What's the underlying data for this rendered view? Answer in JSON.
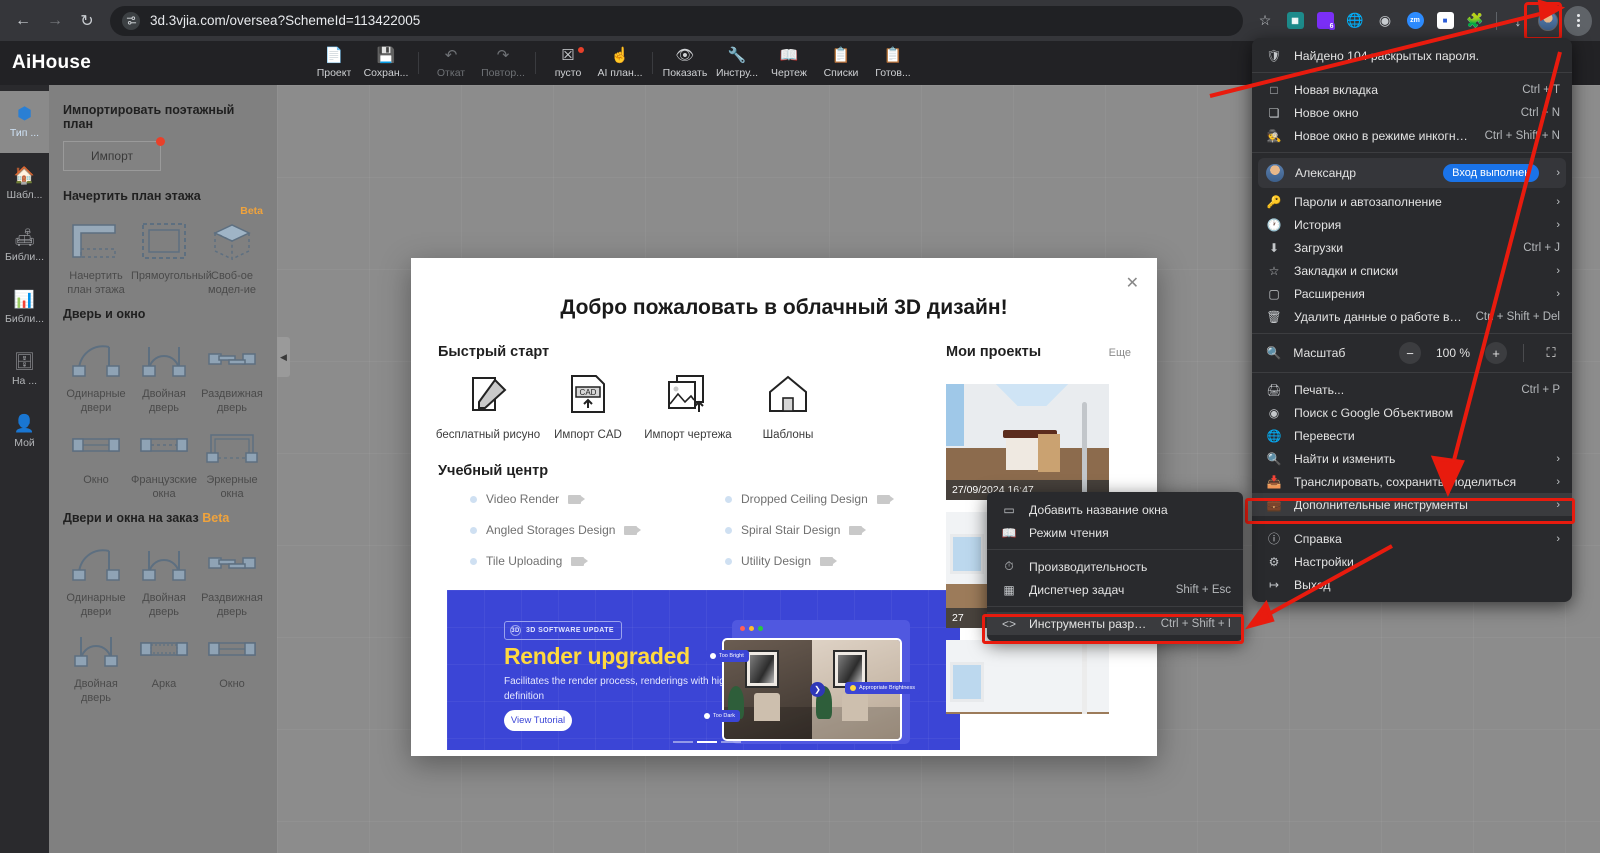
{
  "browser": {
    "url": "3d.3vjia.com/oversea?SchemeId=113422005",
    "back_icon": "arrow-left-icon",
    "forward_icon": "arrow-right-icon",
    "reload_icon": "reload-icon",
    "site_info_icon": "page-settings-icon",
    "bookmark_icon": "star-icon",
    "download_icon": "download-icon",
    "profile_icon": "avatar-icon",
    "menu_icon": "three-dots-menu-icon",
    "extensions": [
      {
        "name": "qr-extension-icon",
        "label": "",
        "color": "#1d8b8b"
      },
      {
        "name": "purple-badge-extension-icon",
        "label": "6",
        "color": "#7b2ff7"
      },
      {
        "name": "globe-grid-extension-icon",
        "label": "",
        "color": "#8a8d91"
      },
      {
        "name": "globe-extension-icon",
        "label": "",
        "color": "#8a8d91"
      },
      {
        "name": "zoom-extension-icon",
        "label": "zm",
        "color": "#2d8cff"
      },
      {
        "name": "blue-square-extension-icon",
        "label": "",
        "color": "#ffffff"
      },
      {
        "name": "puzzle-extensions-icon",
        "label": "",
        "color": "#8a8d91"
      }
    ]
  },
  "app": {
    "logo": "AiHouse",
    "toolbar": [
      {
        "label": "Проект",
        "icon": "project-icon",
        "dim": false,
        "dot": false
      },
      {
        "label": "Сохран...",
        "icon": "save-icon",
        "dim": false,
        "dot": false
      },
      {
        "label": "Откат",
        "icon": "undo-icon",
        "dim": true,
        "dot": false
      },
      {
        "label": "Повтор...",
        "icon": "redo-icon",
        "dim": true,
        "dot": false
      },
      {
        "label": "пусто",
        "icon": "clear-icon",
        "dim": false,
        "dot": true
      },
      {
        "label": "AI план...",
        "icon": "ai-plan-icon",
        "dim": false,
        "dot": false
      },
      {
        "label": "Показать",
        "icon": "eye-icon",
        "dim": false,
        "dot": false
      },
      {
        "label": "Инстру...",
        "icon": "wrench-icon",
        "dim": false,
        "dot": false
      },
      {
        "label": "Чертеж",
        "icon": "blueprint-icon",
        "dim": false,
        "dot": false
      },
      {
        "label": "Списки",
        "icon": "lists-icon",
        "dim": false,
        "dot": false
      },
      {
        "label": "Готов...",
        "icon": "ready-icon",
        "dim": false,
        "dot": false
      }
    ],
    "rail": [
      {
        "label": "Тип ...",
        "icon": "cube-icon",
        "active": true
      },
      {
        "label": "Шабл...",
        "icon": "template-house-icon",
        "active": false
      },
      {
        "label": "Библи...",
        "icon": "furniture-library-icon",
        "active": false
      },
      {
        "label": "Библи...",
        "icon": "materials-library-icon",
        "active": false
      },
      {
        "label": "На ...",
        "icon": "cabinet-icon",
        "active": false
      },
      {
        "label": "Мой",
        "icon": "person-icon",
        "active": false
      }
    ],
    "panel": {
      "import_title": "Импортировать поэтажный план",
      "import_button": "Импорт",
      "draw_title": "Начертить план этажа",
      "draw_items": [
        {
          "label": "Начертить план этажа",
          "icon": "draw-floorplan-icon",
          "beta": ""
        },
        {
          "label": "Прямоугольный",
          "icon": "rectangle-room-icon",
          "beta": ""
        },
        {
          "label": "Своб-ое модел-ие",
          "icon": "free-modeling-cube-icon",
          "beta": "Beta"
        }
      ],
      "door_window_title": "Дверь и окно",
      "door_window_items": [
        {
          "label": "Одинарные двери",
          "icon": "single-door-icon"
        },
        {
          "label": "Двойная дверь",
          "icon": "double-door-icon"
        },
        {
          "label": "Раздвижная дверь",
          "icon": "sliding-door-icon"
        },
        {
          "label": "Окно",
          "icon": "window-icon"
        },
        {
          "label": "Французские окна",
          "icon": "french-window-icon"
        },
        {
          "label": "Эркерные окна",
          "icon": "bay-window-icon"
        }
      ],
      "custom_title": "Двери и окна на заказ",
      "custom_title_beta": "Beta",
      "custom_items": [
        {
          "label": "Одинарные двери",
          "icon": "single-door-icon"
        },
        {
          "label": "Двойная дверь",
          "icon": "double-door-icon"
        },
        {
          "label": "Раздвижная дверь",
          "icon": "sliding-door-icon"
        },
        {
          "label": "Двойная дверь",
          "icon": "double-door-icon"
        },
        {
          "label": "Арка",
          "icon": "arch-icon"
        },
        {
          "label": "Окно",
          "icon": "window-icon"
        }
      ],
      "collapse_icon": "chevron-left-icon"
    }
  },
  "modal": {
    "close_icon": "close-icon",
    "title": "Добро пожаловать в облачный 3D дизайн!",
    "quick_start_title": "Быстрый старт",
    "quick_start": [
      {
        "label": "бесплатный рисуно",
        "icon": "free-draw-icon"
      },
      {
        "label": "Импорт CAD",
        "icon": "cad-import-icon"
      },
      {
        "label": "Импорт чертежа",
        "icon": "drawing-import-icon"
      },
      {
        "label": "Шаблоны",
        "icon": "templates-house-icon"
      }
    ],
    "learning_title": "Учебный центр",
    "learning_items": [
      {
        "label": "Video Render",
        "icon": "video-icon"
      },
      {
        "label": "Dropped Ceiling Design",
        "icon": "video-icon"
      },
      {
        "label": "Angled Storages Design",
        "icon": "video-icon"
      },
      {
        "label": "Spiral Stair Design",
        "icon": "video-icon"
      },
      {
        "label": "Tile Uploading",
        "icon": "video-icon"
      },
      {
        "label": "Utility Design",
        "icon": "video-icon"
      }
    ],
    "banner": {
      "tag": "3D SOFTWARE UPDATE",
      "headline": "Render upgraded",
      "subtext": "Facilitates the render process, renderings with higher-definition",
      "button": "View Tutorial",
      "pill_left_top": "Too Bright",
      "pill_left_bottom": "Too Dark",
      "pill_right": "Appropriate Brightness",
      "next_icon": "chevron-right-icon",
      "slide_count": 3,
      "active_slide": 2
    },
    "projects": {
      "title": "Мои проекты",
      "more": "Еще",
      "items": [
        {
          "date": "27/09/2024 16:47",
          "thumb": "room-a"
        },
        {
          "date": "27",
          "thumb": "room-b"
        },
        {
          "date": "",
          "thumb": "room-b"
        }
      ]
    }
  },
  "chrome_menu": {
    "password_alert": {
      "label": "Найдено 104 раскрытых пароля.",
      "icon": "shield-icon"
    },
    "group1": [
      {
        "label": "Новая вкладка",
        "shortcut": "Ctrl + T",
        "icon": "new-tab-icon",
        "arrow": false
      },
      {
        "label": "Новое окно",
        "shortcut": "Ctrl + N",
        "icon": "new-window-icon",
        "arrow": false
      },
      {
        "label": "Новое окно в режиме инкогнито",
        "shortcut": "Ctrl + Shift + N",
        "icon": "incognito-icon",
        "arrow": false
      }
    ],
    "profile": {
      "name": "Александр",
      "badge": "Вход выполнен",
      "icon": "avatar-icon",
      "arrow": true
    },
    "group2": [
      {
        "label": "Пароли и автозаполнение",
        "shortcut": "",
        "icon": "key-icon",
        "arrow": true
      },
      {
        "label": "История",
        "shortcut": "",
        "icon": "history-icon",
        "arrow": true
      },
      {
        "label": "Загрузки",
        "shortcut": "Ctrl + J",
        "icon": "download-icon",
        "arrow": false
      },
      {
        "label": "Закладки и списки",
        "shortcut": "",
        "icon": "star-icon",
        "arrow": true
      },
      {
        "label": "Расширения",
        "shortcut": "",
        "icon": "puzzle-icon",
        "arrow": true
      },
      {
        "label": "Удалить данные о работе в браузере...",
        "shortcut": "Ctrl + Shift + Del",
        "icon": "trash-icon",
        "arrow": false
      }
    ],
    "zoom": {
      "label": "Масштаб",
      "icon": "zoom-icon",
      "minus": "−",
      "value": "100 %",
      "plus": "+",
      "fullscreen_icon": "fullscreen-icon"
    },
    "group3": [
      {
        "label": "Печать...",
        "shortcut": "Ctrl + P",
        "icon": "print-icon",
        "arrow": false
      },
      {
        "label": "Поиск с Google Объективом",
        "shortcut": "",
        "icon": "lens-icon",
        "arrow": false
      },
      {
        "label": "Перевести",
        "shortcut": "",
        "icon": "translate-icon",
        "arrow": false
      },
      {
        "label": "Найти и изменить",
        "shortcut": "",
        "icon": "find-icon",
        "arrow": true
      },
      {
        "label": "Транслировать, сохранить, поделиться",
        "shortcut": "",
        "icon": "cast-icon",
        "arrow": true
      },
      {
        "label": "Дополнительные инструменты",
        "shortcut": "",
        "icon": "toolbox-icon",
        "arrow": true,
        "highlight": true
      }
    ],
    "group4": [
      {
        "label": "Справка",
        "shortcut": "",
        "icon": "help-icon",
        "arrow": true
      },
      {
        "label": "Настройки",
        "shortcut": "",
        "icon": "gear-icon",
        "arrow": false
      },
      {
        "label": "Выход",
        "shortcut": "",
        "icon": "exit-icon",
        "arrow": false
      }
    ]
  },
  "submenu": {
    "group1": [
      {
        "label": "Добавить название окна",
        "shortcut": "",
        "icon": "window-name-icon"
      },
      {
        "label": "Режим чтения",
        "shortcut": "",
        "icon": "reading-mode-icon"
      }
    ],
    "group2": [
      {
        "label": "Производительность",
        "shortcut": "",
        "icon": "performance-icon"
      },
      {
        "label": "Диспетчер задач",
        "shortcut": "Shift + Esc",
        "icon": "task-manager-icon"
      }
    ],
    "group3": [
      {
        "label": "Инструменты разработчика",
        "shortcut": "Ctrl + Shift + I",
        "icon": "devtools-icon",
        "highlight": true
      }
    ]
  },
  "colors": {
    "annotation_red": "#e81b0e",
    "accent_blue": "#1a73e8",
    "beta_orange": "#f0a33c"
  }
}
